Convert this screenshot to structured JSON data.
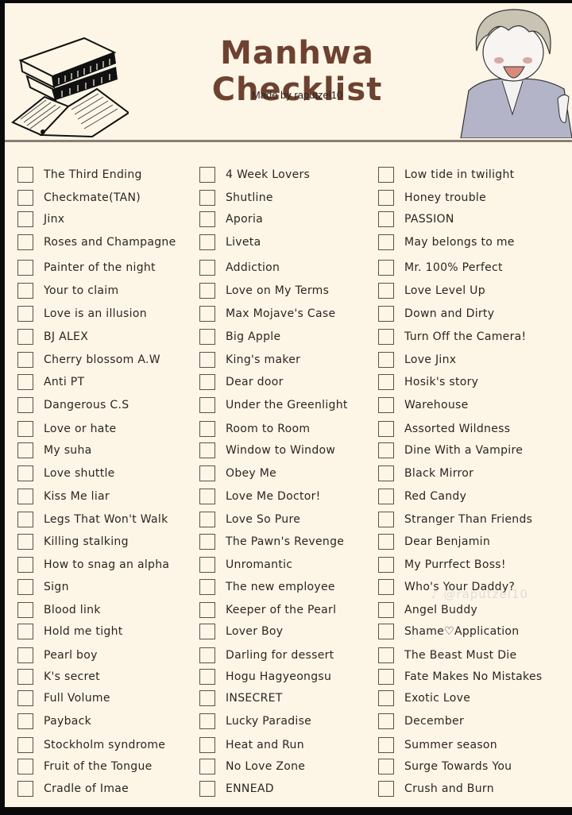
{
  "header": {
    "title": "Manhwa Checklist",
    "subtitle": "Made by raputzel10"
  },
  "watermark": "♪ @raputzel10",
  "colors": {
    "background": "#fdf6e7",
    "title": "#6e4230",
    "text": "#2b2520",
    "checkbox_border": "#5a5248",
    "divider": "#8a7e72"
  },
  "columns": [
    {
      "items": [
        {
          "label": "The Third Ending",
          "checked": false
        },
        {
          "label": "Checkmate(TAN)",
          "checked": false
        },
        {
          "label": "Jinx",
          "checked": false
        },
        {
          "label": "Roses and Champagne",
          "checked": false
        },
        {
          "label": "Painter of the night",
          "checked": false
        },
        {
          "label": "Your to claim",
          "checked": false
        },
        {
          "label": "Love is an illusion",
          "checked": false
        },
        {
          "label": "BJ ALEX",
          "checked": false
        },
        {
          "label": "Cherry blossom A.W",
          "checked": false
        },
        {
          "label": "Anti PT",
          "checked": false
        },
        {
          "label": "Dangerous C.S",
          "checked": false
        },
        {
          "label": "Love or hate",
          "checked": false
        },
        {
          "label": "My suha",
          "checked": false
        },
        {
          "label": "Love shuttle",
          "checked": false
        },
        {
          "label": "Kiss Me liar",
          "checked": false
        },
        {
          "label": "Legs That Won't Walk",
          "checked": false
        },
        {
          "label": "Killing stalking",
          "checked": false
        },
        {
          "label": "How to snag an alpha",
          "checked": false
        },
        {
          "label": "Sign",
          "checked": false
        },
        {
          "label": "Blood link",
          "checked": false
        },
        {
          "label": "Hold me tight",
          "checked": false
        },
        {
          "label": "Pearl boy",
          "checked": false
        },
        {
          "label": "K's secret",
          "checked": false
        },
        {
          "label": "Full Volume",
          "checked": false
        },
        {
          "label": "Payback",
          "checked": false
        },
        {
          "label": "Stockholm syndrome",
          "checked": false
        },
        {
          "label": "Fruit of the Tongue",
          "checked": false
        },
        {
          "label": "Cradle of Imae",
          "checked": false
        }
      ]
    },
    {
      "items": [
        {
          "label": "4 Week Lovers",
          "checked": false
        },
        {
          "label": "Shutline",
          "checked": false
        },
        {
          "label": "Aporia",
          "checked": false
        },
        {
          "label": "Liveta",
          "checked": false
        },
        {
          "label": "Addiction",
          "checked": false
        },
        {
          "label": "Love on My Terms",
          "checked": false
        },
        {
          "label": "Max Mojave's Case",
          "checked": false
        },
        {
          "label": "Big Apple",
          "checked": false
        },
        {
          "label": "King's maker",
          "checked": false
        },
        {
          "label": "Dear door",
          "checked": false
        },
        {
          "label": "Under the Greenlight",
          "checked": false
        },
        {
          "label": "Room to Room",
          "checked": false
        },
        {
          "label": "Window to Window",
          "checked": false
        },
        {
          "label": "Obey Me",
          "checked": false
        },
        {
          "label": "Love Me Doctor!",
          "checked": false
        },
        {
          "label": "Love So Pure",
          "checked": false
        },
        {
          "label": "The Pawn's Revenge",
          "checked": false
        },
        {
          "label": "Unromantic",
          "checked": false
        },
        {
          "label": "The new employee",
          "checked": false
        },
        {
          "label": "Keeper of the Pearl",
          "checked": false
        },
        {
          "label": "Lover Boy",
          "checked": false
        },
        {
          "label": "Darling for dessert",
          "checked": false
        },
        {
          "label": "Hogu Hagyeongsu",
          "checked": false
        },
        {
          "label": "INSECRET",
          "checked": false
        },
        {
          "label": "Lucky Paradise",
          "checked": false
        },
        {
          "label": "Heat and Run",
          "checked": false
        },
        {
          "label": "No Love Zone",
          "checked": false
        },
        {
          "label": "ENNEAD",
          "checked": false
        }
      ]
    },
    {
      "items": [
        {
          "label": "Low tide in twilight",
          "checked": false
        },
        {
          "label": "Honey trouble",
          "checked": false
        },
        {
          "label": "PASSION",
          "checked": false
        },
        {
          "label": "May belongs to me",
          "checked": false
        },
        {
          "label": "Mr. 100% Perfect",
          "checked": false
        },
        {
          "label": "Love Level Up",
          "checked": false
        },
        {
          "label": "Down and Dirty",
          "checked": false
        },
        {
          "label": "Turn Off the Camera!",
          "checked": false
        },
        {
          "label": "Love Jinx",
          "checked": false
        },
        {
          "label": "Hosik's story",
          "checked": false
        },
        {
          "label": "Warehouse",
          "checked": false
        },
        {
          "label": "Assorted Wildness",
          "checked": false
        },
        {
          "label": "Dine With a Vampire",
          "checked": false
        },
        {
          "label": "Black Mirror",
          "checked": false
        },
        {
          "label": "Red Candy",
          "checked": false
        },
        {
          "label": "Stranger Than Friends",
          "checked": false
        },
        {
          "label": "Dear Benjamin",
          "checked": false
        },
        {
          "label": "My Purrfect Boss!",
          "checked": false
        },
        {
          "label": "Who's Your Daddy?",
          "checked": false
        },
        {
          "label": "Angel Buddy",
          "checked": false
        },
        {
          "label": "Shame♡Application",
          "checked": false
        },
        {
          "label": "The Beast Must Die",
          "checked": false
        },
        {
          "label": "Fate Makes No Mistakes",
          "checked": false
        },
        {
          "label": "Exotic Love",
          "checked": false
        },
        {
          "label": "December",
          "checked": false
        },
        {
          "label": "Summer season",
          "checked": false
        },
        {
          "label": "Surge Towards You",
          "checked": false
        },
        {
          "label": "Crush and Burn",
          "checked": false
        }
      ]
    }
  ]
}
